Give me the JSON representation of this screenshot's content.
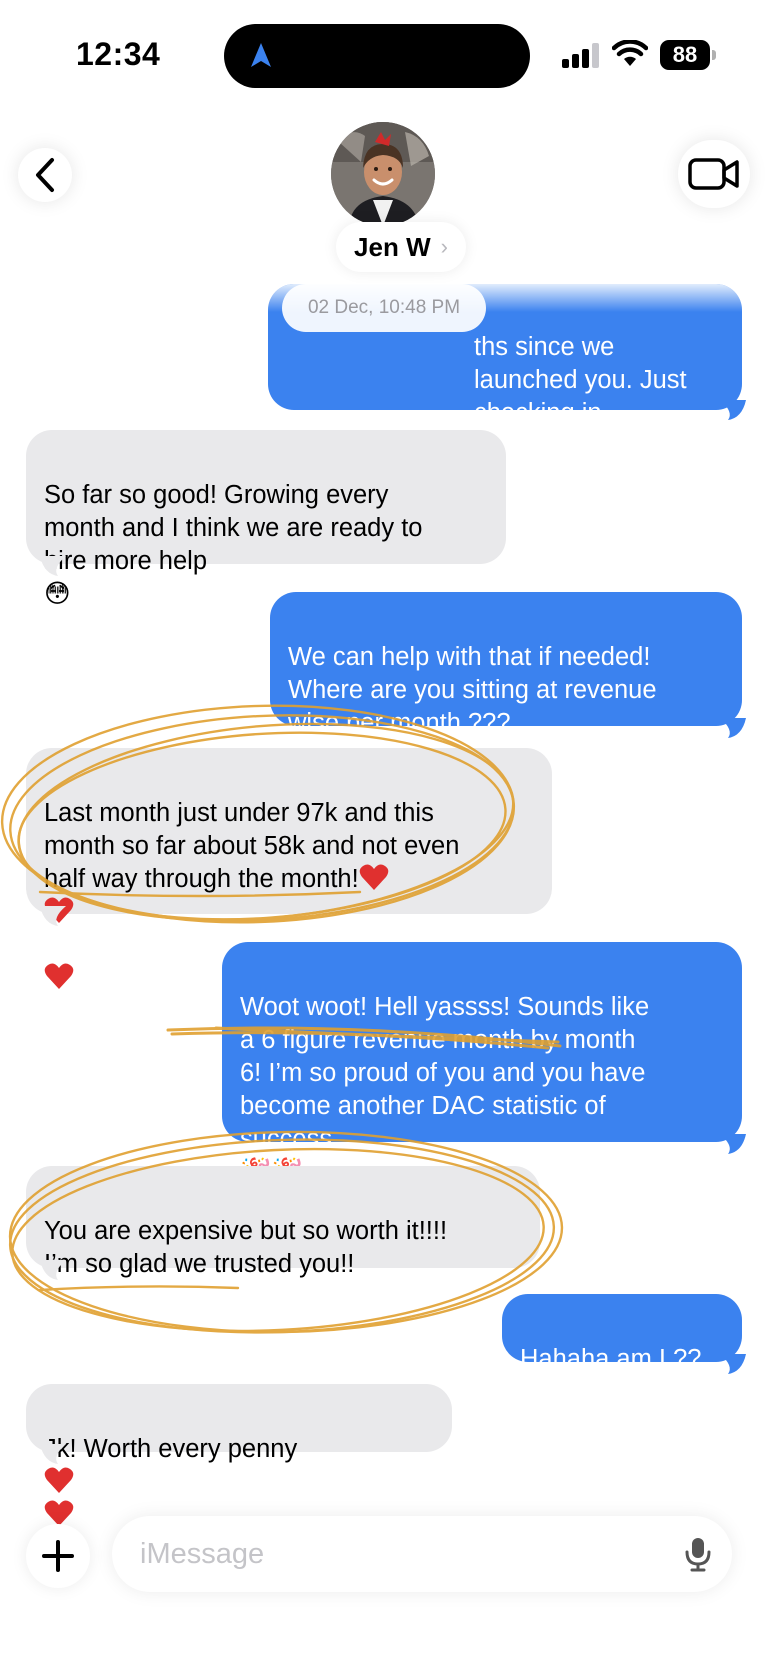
{
  "status_bar": {
    "time": "12:34",
    "battery_level": "88",
    "icons": [
      "location-arrow-icon",
      "cellular-signal-icon",
      "wifi-icon",
      "battery-icon"
    ]
  },
  "header": {
    "contact_name": "Jen W",
    "icons": [
      "chevron-left-icon",
      "video-camera-icon",
      "chevron-right-icon"
    ]
  },
  "conversation": {
    "timestamp": "02 Dec, 10:48 PM",
    "messages": [
      {
        "direction": "out",
        "text": "ths since we\nlaunched you.  Just checking in..\nHow’s everything going ?"
      },
      {
        "direction": "in",
        "text": "So far so good!  Growing every\nmonth and I think we are ready to\nhire more help",
        "emoji": "😳"
      },
      {
        "direction": "out",
        "text": "We can help with that if needed!\nWhere are you sitting at revenue\nwise per month ???"
      },
      {
        "direction": "in",
        "text": "Last month just under 97k and this\nmonth so far about 58k and not even\nhalf way through the month!"
      },
      {
        "direction": "out",
        "text": "Woot woot! Hell yassss!  Sounds like\na 6 figure revenue month by month\n6!  I’m so proud of you and you have\nbecome another DAC statistic of\nsuccess",
        "emoji": "🎉🎉"
      },
      {
        "direction": "in",
        "text": "You are expensive but so worth it!!!!\nI’m so glad we trusted you!!"
      },
      {
        "direction": "out",
        "text": "Hahaha am I ??"
      },
      {
        "direction": "in",
        "text": "Jk!  Worth every penny"
      }
    ]
  },
  "composer": {
    "placeholder": "iMessage",
    "icons": [
      "plus-icon",
      "microphone-icon"
    ]
  },
  "colors": {
    "outgoing_bubble": "#3b82ef",
    "incoming_bubble": "#e9e9eb",
    "annotation": "#e0a030",
    "heart": "#e0302f"
  }
}
